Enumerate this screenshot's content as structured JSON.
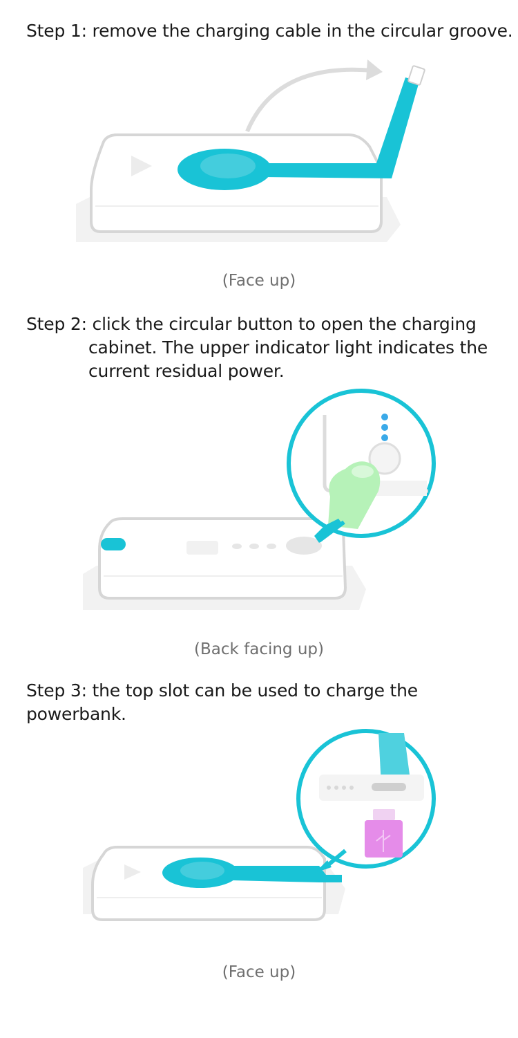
{
  "steps": [
    {
      "lead": "Step 1: remove the charging cable in the circular groove.",
      "cont": []
    },
    {
      "lead": "Step 2: click the circular button to open the charging",
      "cont": [
        "cabinet. The upper indicator light indicates the",
        "current residual power."
      ]
    },
    {
      "lead": "Step 3: the top slot can be used to charge the powerbank.",
      "cont": []
    }
  ],
  "captions": [
    "(Face up)",
    "(Back facing up)",
    "(Face up)"
  ],
  "colors": {
    "accent": "#19c3d6",
    "outline": "#d6d6d6",
    "shadow": "#f1f1f1",
    "finger": "#b6f2b8",
    "usb": "#e58ce9"
  },
  "icons": [
    "curved-arrow-icon",
    "play-triangle-icon",
    "power-button-icon",
    "indicator-light-icon",
    "finger-icon",
    "usb-plug-icon"
  ]
}
